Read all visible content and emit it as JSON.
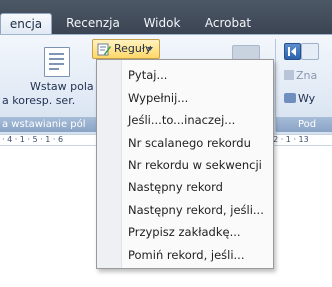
{
  "tabs": [
    {
      "label": "encja",
      "active": true
    },
    {
      "label": "Recenzja",
      "active": false
    },
    {
      "label": "Widok",
      "active": false
    },
    {
      "label": "Acrobat",
      "active": false
    }
  ],
  "ribbon": {
    "insert_field_button": {
      "line1": "Wstaw pola",
      "line2": "a  koresp. ser."
    },
    "group_caption_left": "a  wstawianie pól",
    "group_caption_right": "Pod",
    "rules_button": {
      "label": "Reguły",
      "icon": "rules-icon"
    },
    "right_partial_1": "Zna",
    "right_partial_2": "Wy"
  },
  "ruler": {
    "left": "· 4 · 1 · 5 · 1 · 6",
    "right": "12 · 1 · 13"
  },
  "menu": {
    "items": [
      {
        "label": "Pytaj..."
      },
      {
        "label": "Wypełnij..."
      },
      {
        "label": "Jeśli...to...inaczej..."
      },
      {
        "label": "Nr scalanego rekordu"
      },
      {
        "label": "Nr rekordu w sekwencji"
      },
      {
        "label": "Następny rekord"
      },
      {
        "label": "Następny rekord, jeśli..."
      },
      {
        "label": "Przypisz zakładkę..."
      },
      {
        "label": "Pomiń rekord, jeśli..."
      }
    ]
  },
  "colors": {
    "tab_bar": "#4d5867",
    "ribbon": "#e3ebf6",
    "accent_button": "#ffd768",
    "menu_bg": "#fafafa"
  }
}
